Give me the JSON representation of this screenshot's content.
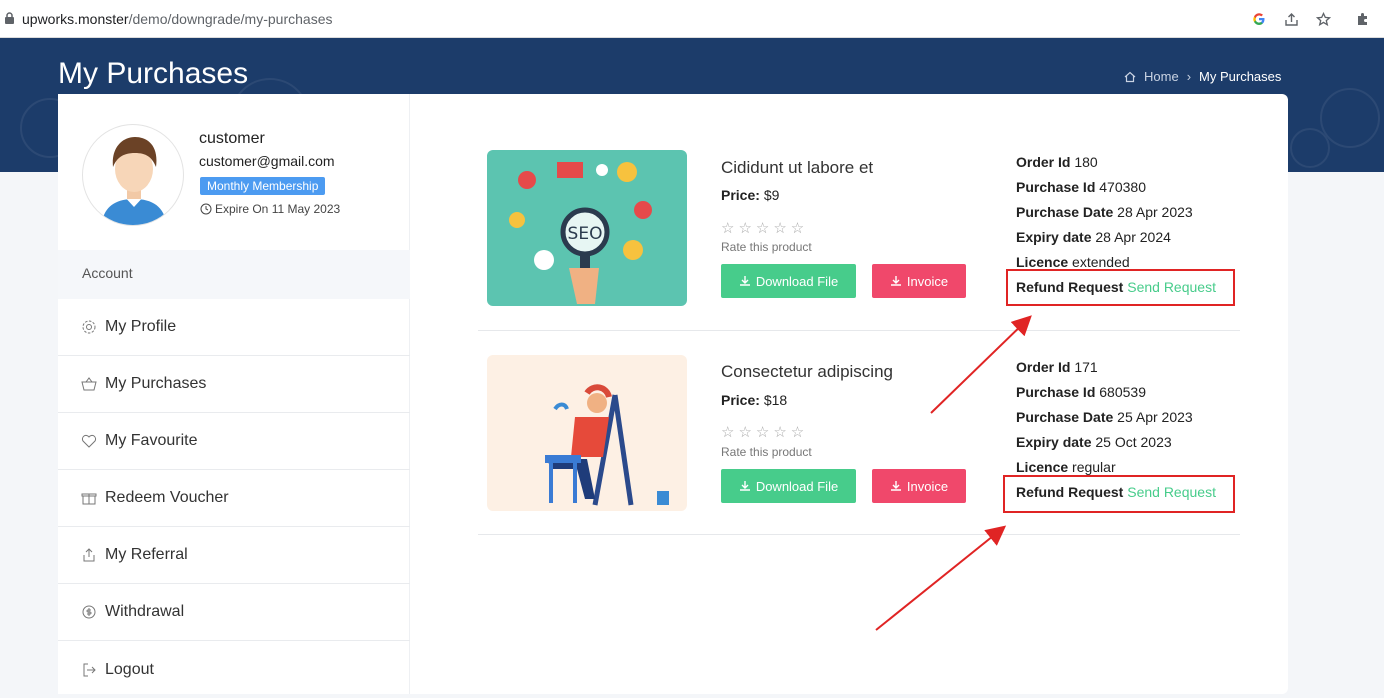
{
  "browser": {
    "url_domain": "upworks.monster",
    "url_path": "/demo/downgrade/my-purchases"
  },
  "header": {
    "title": "My Purchases",
    "breadcrumb_home": "Home",
    "breadcrumb_current": "My Purchases"
  },
  "user": {
    "name": "customer",
    "email": "customer@gmail.com",
    "membership": "Monthly Membership",
    "expire": "Expire On 11 May 2023"
  },
  "sidebar": {
    "section": "Account",
    "items": [
      {
        "label": "My Profile",
        "icon": "gear-icon"
      },
      {
        "label": "My Purchases",
        "icon": "basket-icon"
      },
      {
        "label": "My Favourite",
        "icon": "heart-icon"
      },
      {
        "label": "Redeem Voucher",
        "icon": "gift-icon"
      },
      {
        "label": "My Referral",
        "icon": "share-icon"
      },
      {
        "label": "Withdrawal",
        "icon": "money-icon"
      },
      {
        "label": "Logout",
        "icon": "logout-icon"
      }
    ]
  },
  "purchases": [
    {
      "title": "Cididunt ut labore et",
      "price_label": "Price:",
      "price": "$9",
      "stars": "☆☆☆☆☆",
      "rate_text": "Rate this product",
      "download_label": "Download File",
      "invoice_label": "Invoice",
      "order_id_label": "Order Id",
      "order_id": "180",
      "purchase_id_label": "Purchase Id",
      "purchase_id": "470380",
      "purchase_date_label": "Purchase Date",
      "purchase_date": "28 Apr 2023",
      "expiry_label": "Expiry date",
      "expiry": "28 Apr 2024",
      "licence_label": "Licence",
      "licence": "extended",
      "refund_label": "Refund Request",
      "refund_action": "Send Request",
      "image_text": "SEO"
    },
    {
      "title": "Consectetur adipiscing",
      "price_label": "Price:",
      "price": "$18",
      "stars": "☆☆☆☆☆",
      "rate_text": "Rate this product",
      "download_label": "Download File",
      "invoice_label": "Invoice",
      "order_id_label": "Order Id",
      "order_id": "171",
      "purchase_id_label": "Purchase Id",
      "purchase_id": "680539",
      "purchase_date_label": "Purchase Date",
      "purchase_date": "25 Apr 2023",
      "expiry_label": "Expiry date",
      "expiry": "25 Oct 2023",
      "licence_label": "Licence",
      "licence": "regular",
      "refund_label": "Refund Request",
      "refund_action": "Send Request"
    }
  ],
  "colors": {
    "banner": "#1c3c6a",
    "green": "#47cc8b",
    "pink": "#f0486b",
    "badge": "#4c9bf1",
    "annotation": "#e02424"
  }
}
